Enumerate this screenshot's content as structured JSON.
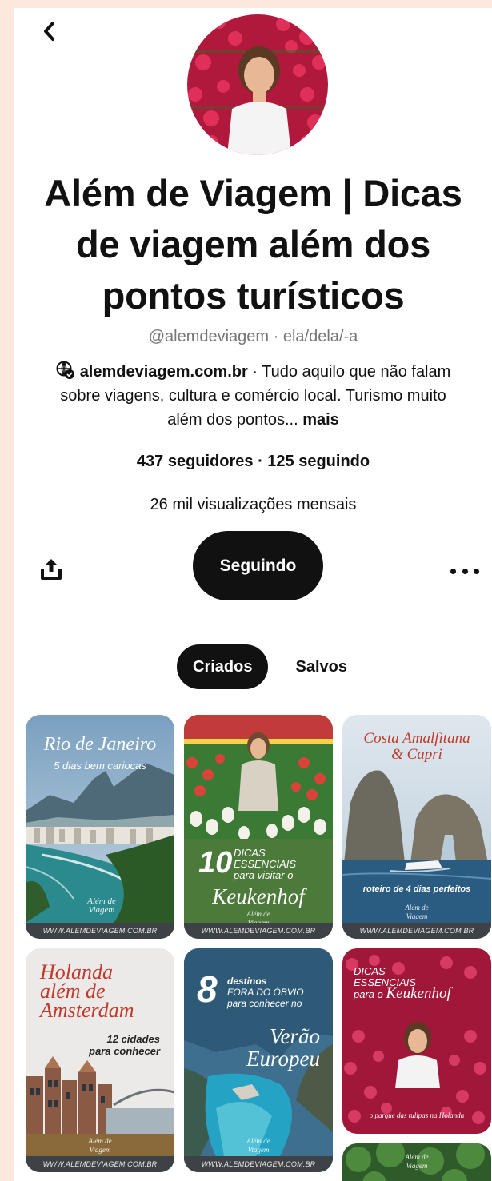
{
  "profile": {
    "name": "Além de Viagem | Dicas de viagem além dos pontos turísticos",
    "handle": "@alemdeviagem · ela/dela/-a",
    "website": "alemdeviagem.com.br",
    "bio_text": " · Tudo aquilo que não falam sobre viagens, cultura e comércio local. Turismo muito além dos pontos... ",
    "more_label": "mais",
    "stats": "437 seguidores · 125 seguindo",
    "monthly_views": "26 mil visualizações mensais"
  },
  "actions": {
    "follow_label": "Seguindo"
  },
  "tabs": [
    {
      "label": "Criados",
      "active": true
    },
    {
      "label": "Salvos",
      "active": false
    }
  ],
  "pins": {
    "footer_url": "WWW.ALEMDEVIAGEM.COM.BR",
    "logo": "Além de Viagem",
    "rio": {
      "title": "Rio de Janeiro",
      "subtitle": "5 dias bem cariocas"
    },
    "keukenhof1": {
      "number": "10",
      "line1": "DICAS",
      "line2": "ESSENCIAIS",
      "line3": "para visitar o",
      "name": "Keukenhof"
    },
    "amalfi": {
      "title_line1": "Costa Amalfitana",
      "title_line2": "& Capri",
      "caption": "roteiro de 4 dias perfeitos"
    },
    "holanda": {
      "line1": "Holanda",
      "line2": "além de",
      "line3": "Amsterdam",
      "sub1": "12 cidades",
      "sub2": "para conhecer"
    },
    "verao": {
      "number": "8",
      "line1": "destinos",
      "line2": "FORA DO ÓBVIO",
      "line3": "para conhecer no",
      "title1": "Verão",
      "title2": "Europeu"
    },
    "keukenhof2": {
      "line1": "DICAS",
      "line2": "ESSENCIAIS",
      "line3": "para o",
      "name": "Keukenhof",
      "caption": "o parque das tulipas na Holanda"
    }
  },
  "colors": {
    "background": "#fde8de",
    "button": "#111111",
    "accent_red": "#c0392b"
  }
}
